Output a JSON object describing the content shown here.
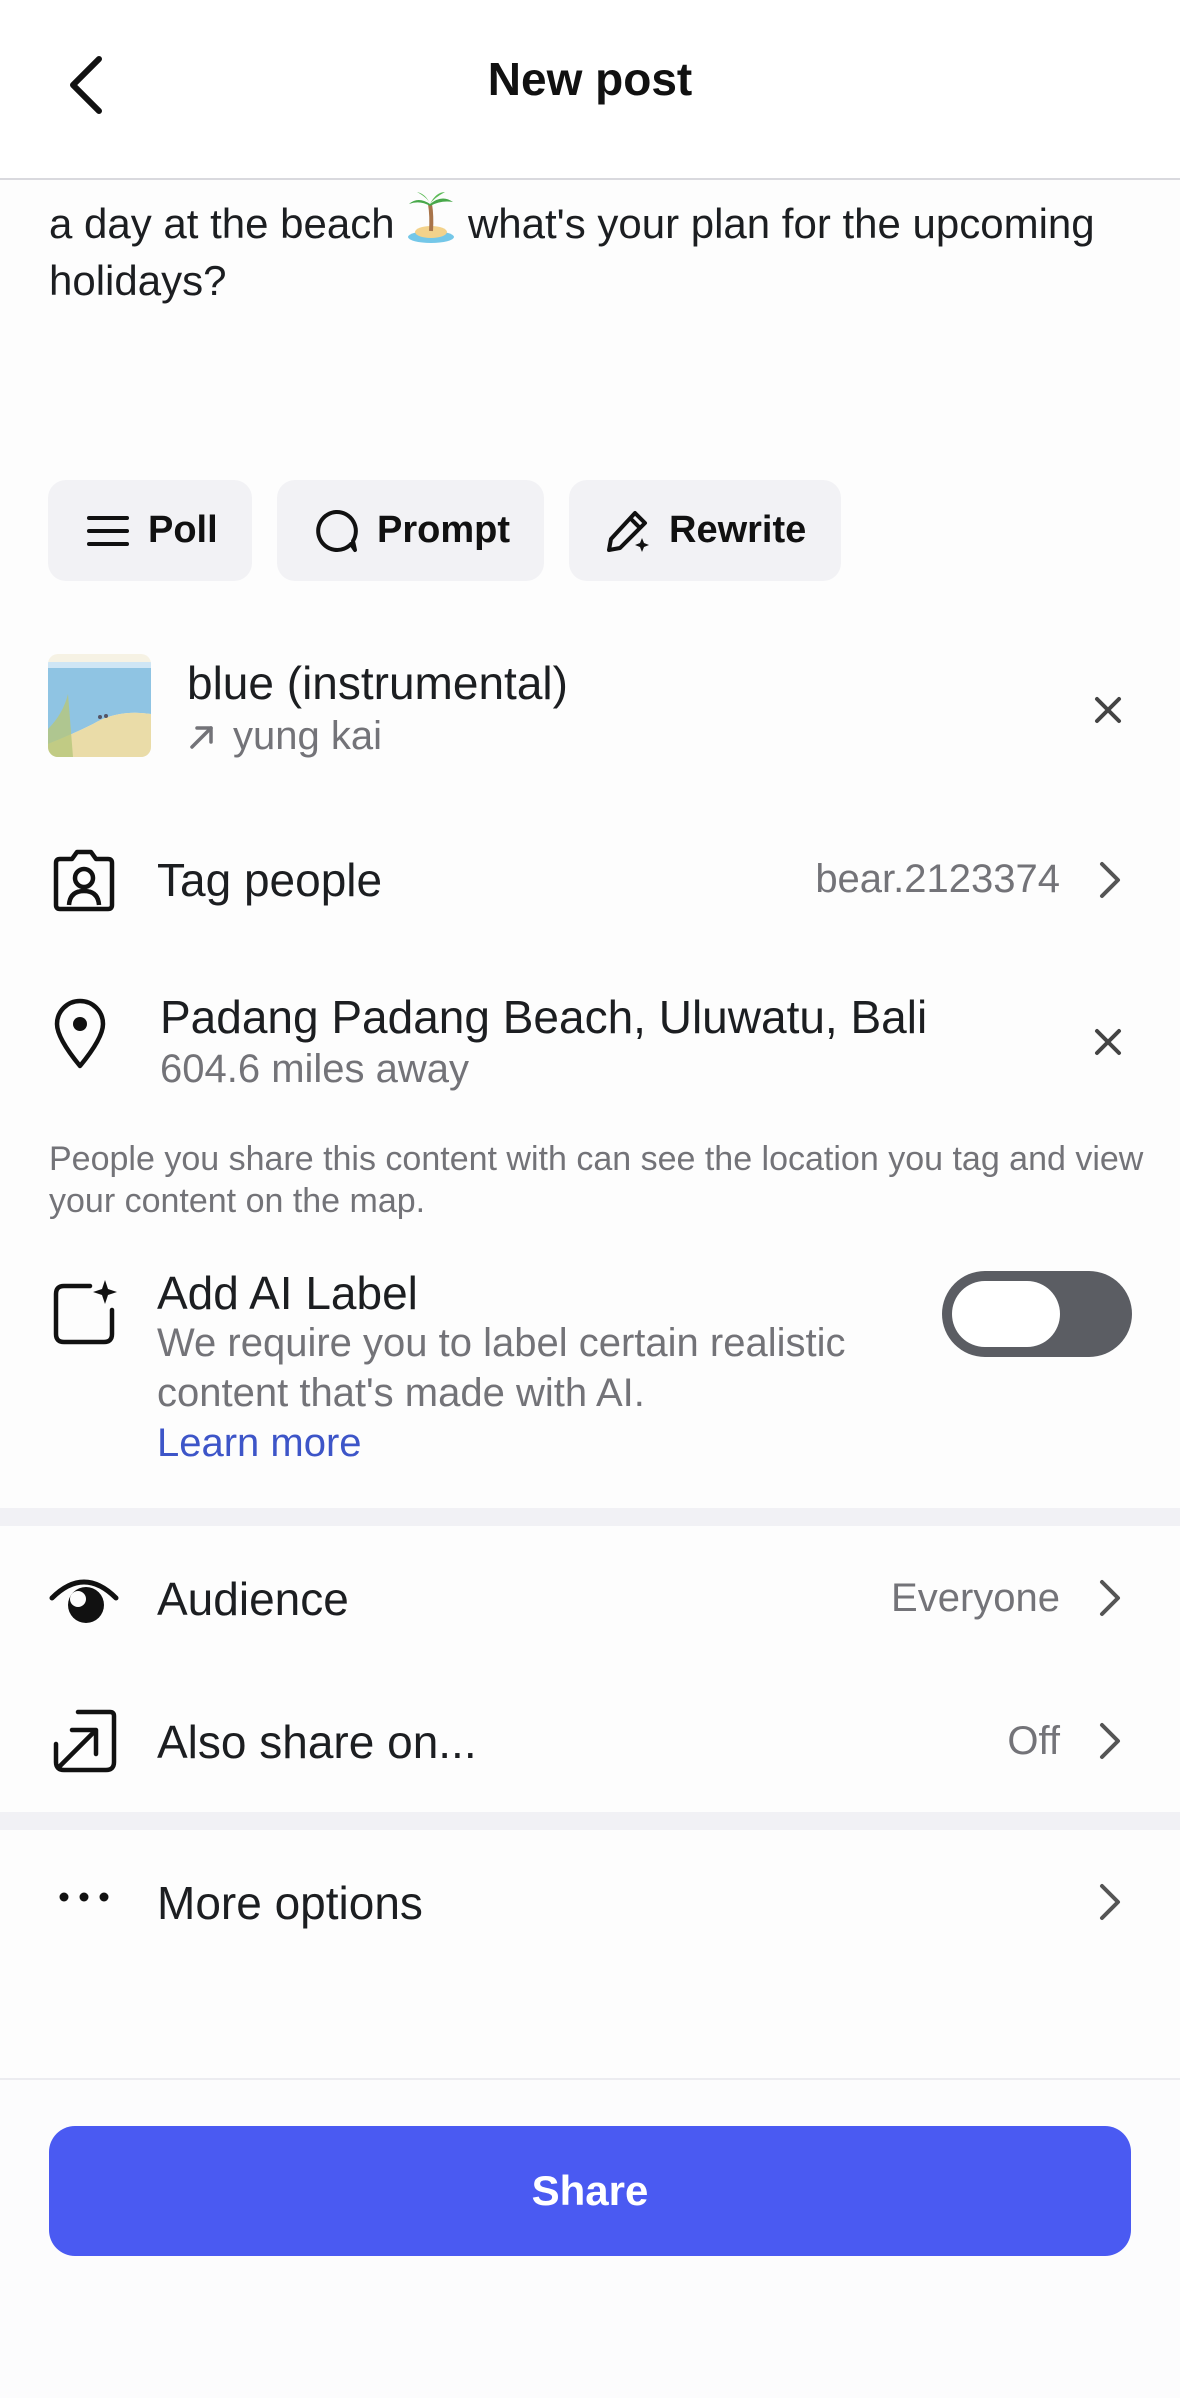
{
  "header": {
    "title": "New post"
  },
  "caption": {
    "text_before": "a day at the beach",
    "text_after": "what's your plan for the upcoming holidays?"
  },
  "chips": [
    {
      "label": "Poll",
      "icon": "list-icon"
    },
    {
      "label": "Prompt",
      "icon": "speech-bubble-icon"
    },
    {
      "label": "Rewrite",
      "icon": "pencil-sparkle-icon"
    }
  ],
  "music": {
    "title": "blue (instrumental)",
    "artist": "yung kai"
  },
  "tag_people": {
    "label": "Tag people",
    "value": "bear.2123374"
  },
  "location": {
    "name": "Padang Padang Beach, Uluwatu, Bali",
    "distance": "604.6 miles away"
  },
  "location_note": "People you share this content with can see the location you tag and view your content on the map.",
  "ai_label": {
    "title": "Add AI Label",
    "description": "We require you to label certain realistic content that's made with AI.",
    "link": "Learn more",
    "enabled": false
  },
  "audience": {
    "label": "Audience",
    "value": "Everyone"
  },
  "also_share": {
    "label": "Also share on...",
    "value": "Off"
  },
  "more_options": {
    "label": "More options"
  },
  "share_button": {
    "label": "Share"
  },
  "colors": {
    "accent": "#4a5af2",
    "link": "#3d55c8",
    "toggle_off": "#5b5d63"
  }
}
